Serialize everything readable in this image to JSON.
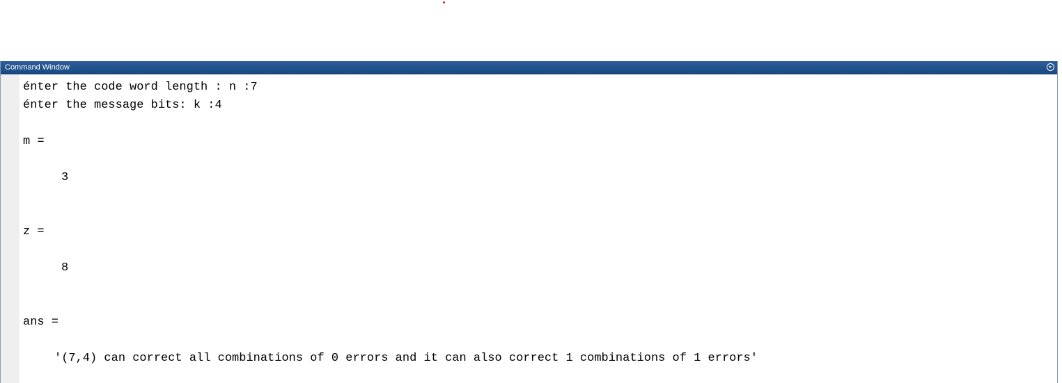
{
  "window": {
    "title": "Command Window"
  },
  "console": {
    "lines": [
      "énter the code word length : n :7",
      "énter the message bits: k :4",
      "m =",
      "3",
      "z =",
      "8",
      "ans =",
      "'(7,4) can correct all combinations of 0 errors and it can also correct 1 combinations of 1 errors'"
    ]
  },
  "colors": {
    "titlebar": "#1f4f8a",
    "gutter": "#efefef",
    "text": "#000000",
    "marker": "#d42020"
  }
}
